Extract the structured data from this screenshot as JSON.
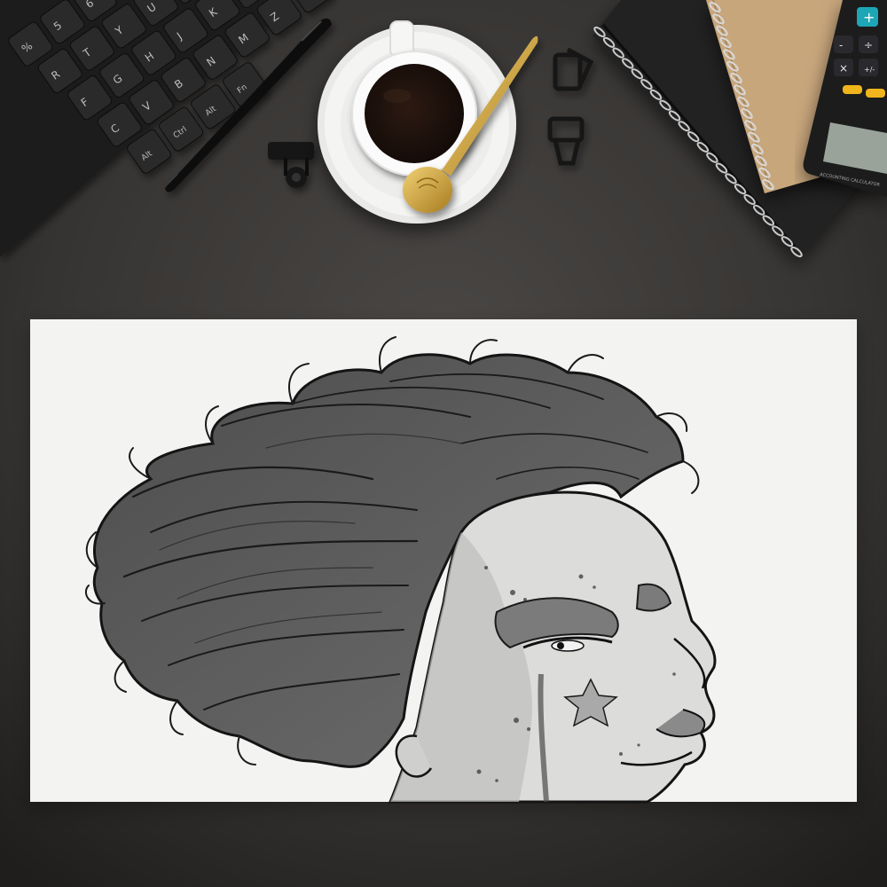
{
  "scene": {
    "kind": "desk-flatlay-mockup",
    "colors": {
      "desk": "#2f2d2b",
      "paper": "#f3f3f2",
      "ink": "#1c1c1c",
      "hair": "#5a5a5a",
      "coffee": "#1e130e",
      "gold": "#d4a737",
      "kraft": "#c9a77c",
      "notebook": "#1f1f1f"
    }
  },
  "keyboard": {
    "keys": [
      "%",
      "5",
      "6",
      "R",
      "T",
      "Y",
      "U",
      "I",
      "O",
      "F",
      "G",
      "H",
      "J",
      "K",
      "L",
      "C",
      "V",
      "B",
      "N",
      "M",
      "Z",
      "X",
      "Alt",
      "Ctrl",
      "Alt",
      "Fn"
    ]
  },
  "calculator": {
    "keys": [
      "+",
      "-",
      "÷",
      "×",
      "+/-"
    ],
    "label": "ACCOUNTING CALCULATOR"
  },
  "icons": [
    "keyboard-icon",
    "pen-icon",
    "coffee-cup-icon",
    "spoon-icon",
    "binder-clip-icon",
    "notebook-icon",
    "calculator-icon"
  ]
}
